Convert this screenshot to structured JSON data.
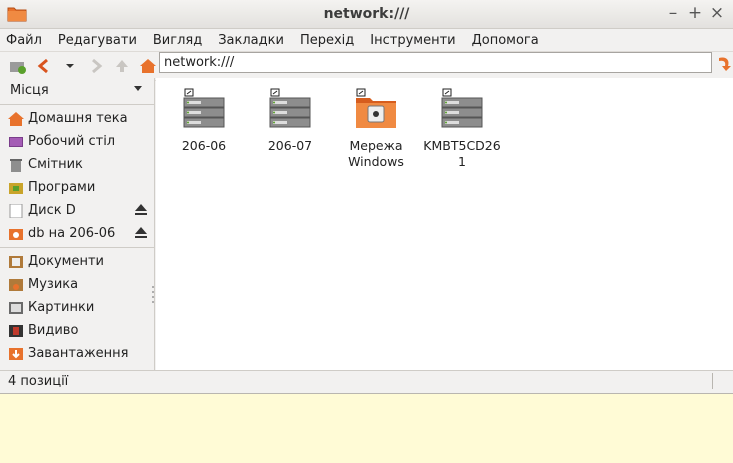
{
  "window": {
    "title": "network:///"
  },
  "menu": [
    "Файл",
    "Редагувати",
    "Вигляд",
    "Закладки",
    "Перехід",
    "Інструменти",
    "Допомога"
  ],
  "location": {
    "value": "network:///"
  },
  "sidebar": {
    "header": "Місця",
    "items": [
      {
        "label": "Домашня тека",
        "icon": "home-folder-icon"
      },
      {
        "label": "Робочий стіл",
        "icon": "desktop-icon"
      },
      {
        "label": "Смітник",
        "icon": "trash-icon"
      },
      {
        "label": "Програми",
        "icon": "applications-icon"
      },
      {
        "label": "Диск D",
        "icon": "drive-icon",
        "eject": true
      },
      {
        "label": "db на 206-06",
        "icon": "network-share-icon",
        "eject": true
      },
      {
        "label": "Документи",
        "icon": "documents-folder-icon"
      },
      {
        "label": "Музика",
        "icon": "music-folder-icon"
      },
      {
        "label": "Картинки",
        "icon": "pictures-folder-icon"
      },
      {
        "label": "Видиво",
        "icon": "videos-folder-icon"
      },
      {
        "label": "Завантаження",
        "icon": "downloads-folder-icon"
      }
    ]
  },
  "files": [
    {
      "line1": "206-06",
      "line2": "",
      "icon": "network-server-icon"
    },
    {
      "line1": "206-07",
      "line2": "",
      "icon": "network-server-icon"
    },
    {
      "line1": "Мережа",
      "line2": "Windows",
      "icon": "network-folder-icon"
    },
    {
      "line1": "KMBT5CD26",
      "line2": "1",
      "icon": "network-server-icon"
    }
  ],
  "status": {
    "text": "4 позиції"
  },
  "colors": {
    "folder_orange": "#e8722c",
    "background": "#fffbd6"
  }
}
